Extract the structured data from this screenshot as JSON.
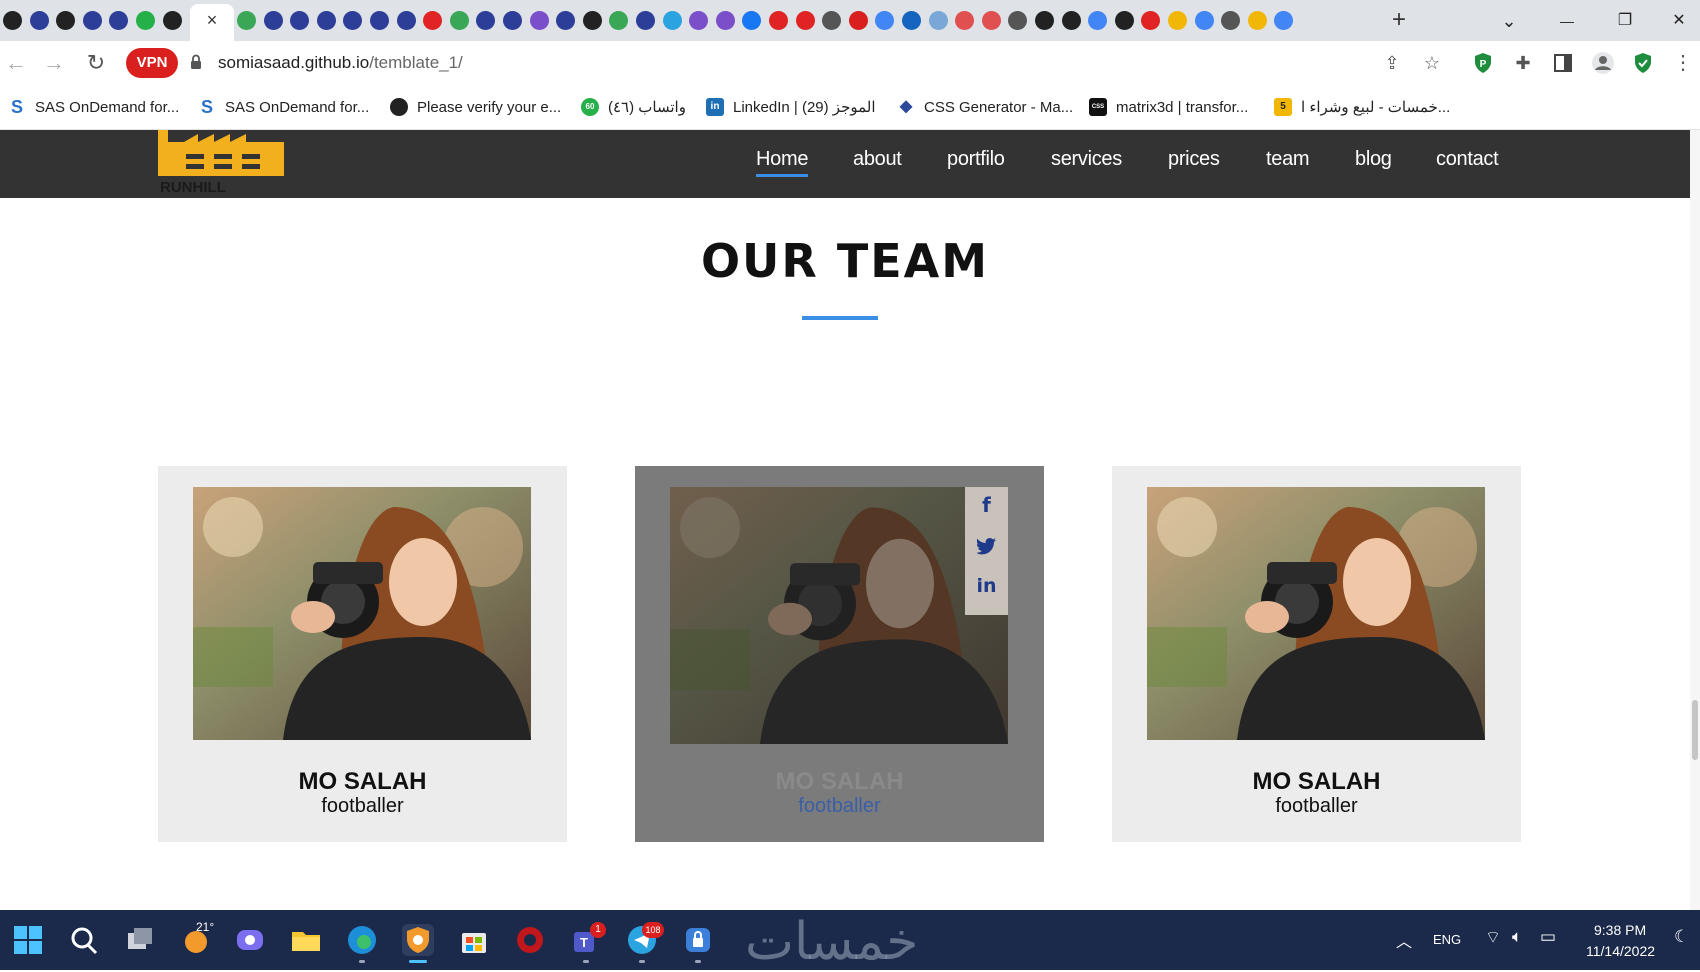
{
  "browser": {
    "tab_close_glyph": "×",
    "new_tab_glyph": "+",
    "window_controls": {
      "chevron": "⌄",
      "minimize": "—",
      "restore": "❐",
      "close": "✕"
    },
    "vpn_label": "VPN",
    "url_host": "somiasaad.github.io",
    "url_path": "/temblate_1/",
    "bookmarks": [
      {
        "label": "SAS OnDemand for...",
        "icon": "sas-icon"
      },
      {
        "label": "SAS OnDemand for...",
        "icon": "sas-icon"
      },
      {
        "label": "Please verify your e...",
        "icon": "github-icon"
      },
      {
        "label": "واتساب (٤٦)",
        "icon": "whatsapp-icon",
        "badge": "60"
      },
      {
        "label": "LinkedIn | الموجز (29)",
        "icon": "linkedin-icon"
      },
      {
        "label": "CSS Generator - Ma...",
        "icon": "css-generator-icon"
      },
      {
        "label": "matrix3d | transfor...",
        "icon": "css3-icon"
      },
      {
        "label": "خمسات - لبيع وشراء ا...",
        "icon": "khamsat-icon",
        "badge": "5"
      }
    ]
  },
  "site": {
    "logo_text": "RUNHILL",
    "nav": [
      "Home",
      "about",
      "portfilo",
      "services",
      "prices",
      "team",
      "blog",
      "contact"
    ],
    "section_title": "OUR TEAM",
    "members": [
      {
        "name": "MO SALAH",
        "role": "footballer",
        "state": "normal"
      },
      {
        "name": "MO SALAH",
        "role": "footballer",
        "state": "hover"
      },
      {
        "name": "MO SALAH",
        "role": "footballer",
        "state": "normal"
      }
    ],
    "social": {
      "facebook": "f",
      "twitter": "t",
      "linkedin": "in"
    }
  },
  "taskbar": {
    "weather_temp": "21°",
    "teams_badge": "1",
    "telegram_badge": "108",
    "language": "ENG",
    "time": "9:38 PM",
    "date": "11/14/2022",
    "watermark": "خمسات"
  },
  "colors": {
    "navbar": "#333333",
    "accent_blue": "#3a8ee6",
    "card_bg": "#ececec",
    "card_hover_bg": "#7b7b7b",
    "taskbar": "#1b2a4a",
    "vpn_red": "#d9201f"
  }
}
